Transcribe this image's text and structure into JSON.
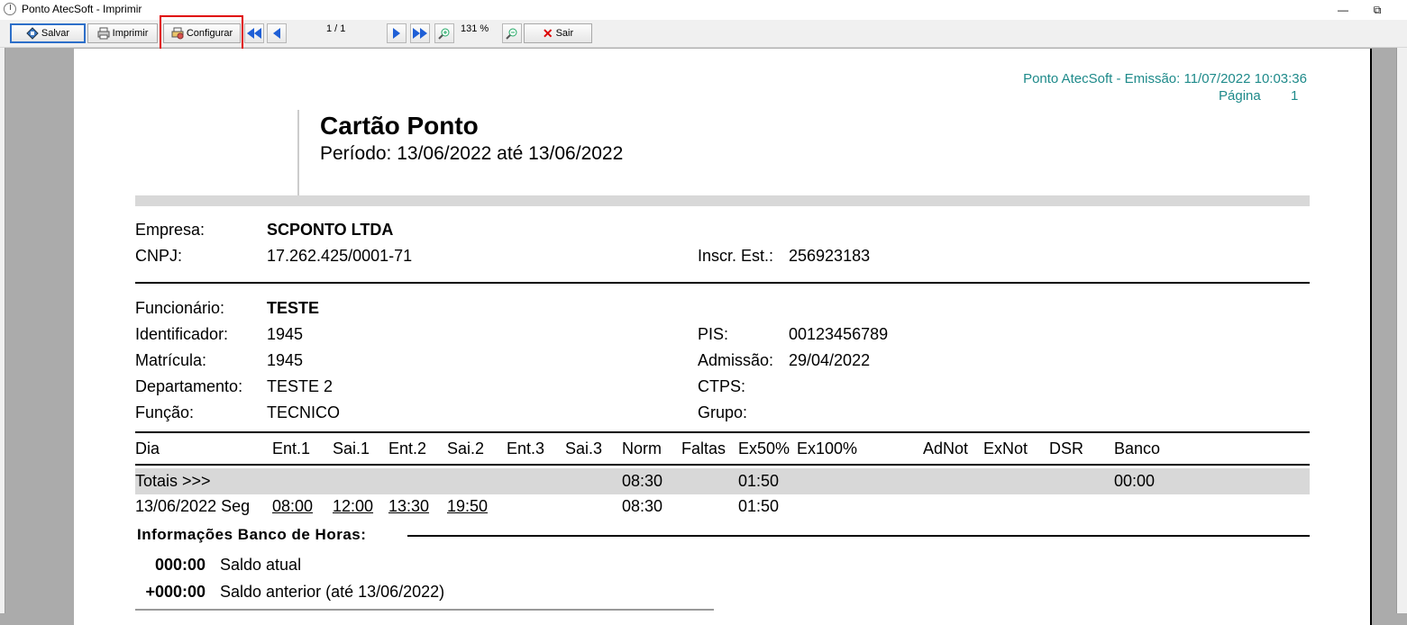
{
  "window": {
    "title": "Ponto AtecSoft - Imprimir",
    "minimize": "—",
    "restore": "⧉"
  },
  "toolbar": {
    "salvar": "Salvar",
    "imprimir": "Imprimir",
    "configurar": "Configurar",
    "page_indicator": "1 / 1",
    "zoom": "131 %",
    "sair": "Sair"
  },
  "report": {
    "header_right": "Ponto AtecSoft - Emissão: 11/07/2022 10:03:36",
    "page_label": "Página",
    "page_number": "1",
    "title": "Cartão Ponto",
    "period": "Período: 13/06/2022 até 13/06/2022",
    "company": {
      "empresa_label": "Empresa:",
      "empresa": "SCPONTO LTDA",
      "cnpj_label": "CNPJ:",
      "cnpj": "17.262.425/0001-71",
      "inscr_label": "Inscr. Est.:",
      "inscr": "256923183"
    },
    "employee": {
      "funcionario_label": "Funcionário:",
      "funcionario": "TESTE",
      "identificador_label": "Identificador:",
      "identificador": "1945",
      "matricula_label": "Matrícula:",
      "matricula": "1945",
      "departamento_label": "Departamento:",
      "departamento": "TESTE 2",
      "funcao_label": "Função:",
      "funcao": "TECNICO",
      "pis_label": "PIS:",
      "pis": "00123456789",
      "admissao_label": "Admissão:",
      "admissao": "29/04/2022",
      "ctps_label": "CTPS:",
      "grupo_label": "Grupo:"
    },
    "columns": [
      "Dia",
      "Ent.1",
      "Sai.1",
      "Ent.2",
      "Sai.2",
      "Ent.3",
      "Sai.3",
      "Norm",
      "Faltas",
      "Ex50%",
      "Ex100%",
      "AdNot",
      "ExNot",
      "DSR",
      "Banco"
    ],
    "totals": {
      "label": "Totais >>>",
      "norm": "08:30",
      "ex50": "01:50",
      "banco": "00:00"
    },
    "row": {
      "dia": "13/06/2022 Seg",
      "ent1": "08:00",
      "sai1": "12:00",
      "ent2": "13:30",
      "sai2": "19:50",
      "norm": "08:30",
      "ex50": "01:50"
    },
    "banco_horas": {
      "title": "Informações Banco de Horas:",
      "saldo_atual_value": "000:00",
      "saldo_atual_label": "Saldo atual",
      "saldo_anterior_value": "+000:00",
      "saldo_anterior_label": "Saldo anterior (até 13/06/2022)"
    }
  }
}
